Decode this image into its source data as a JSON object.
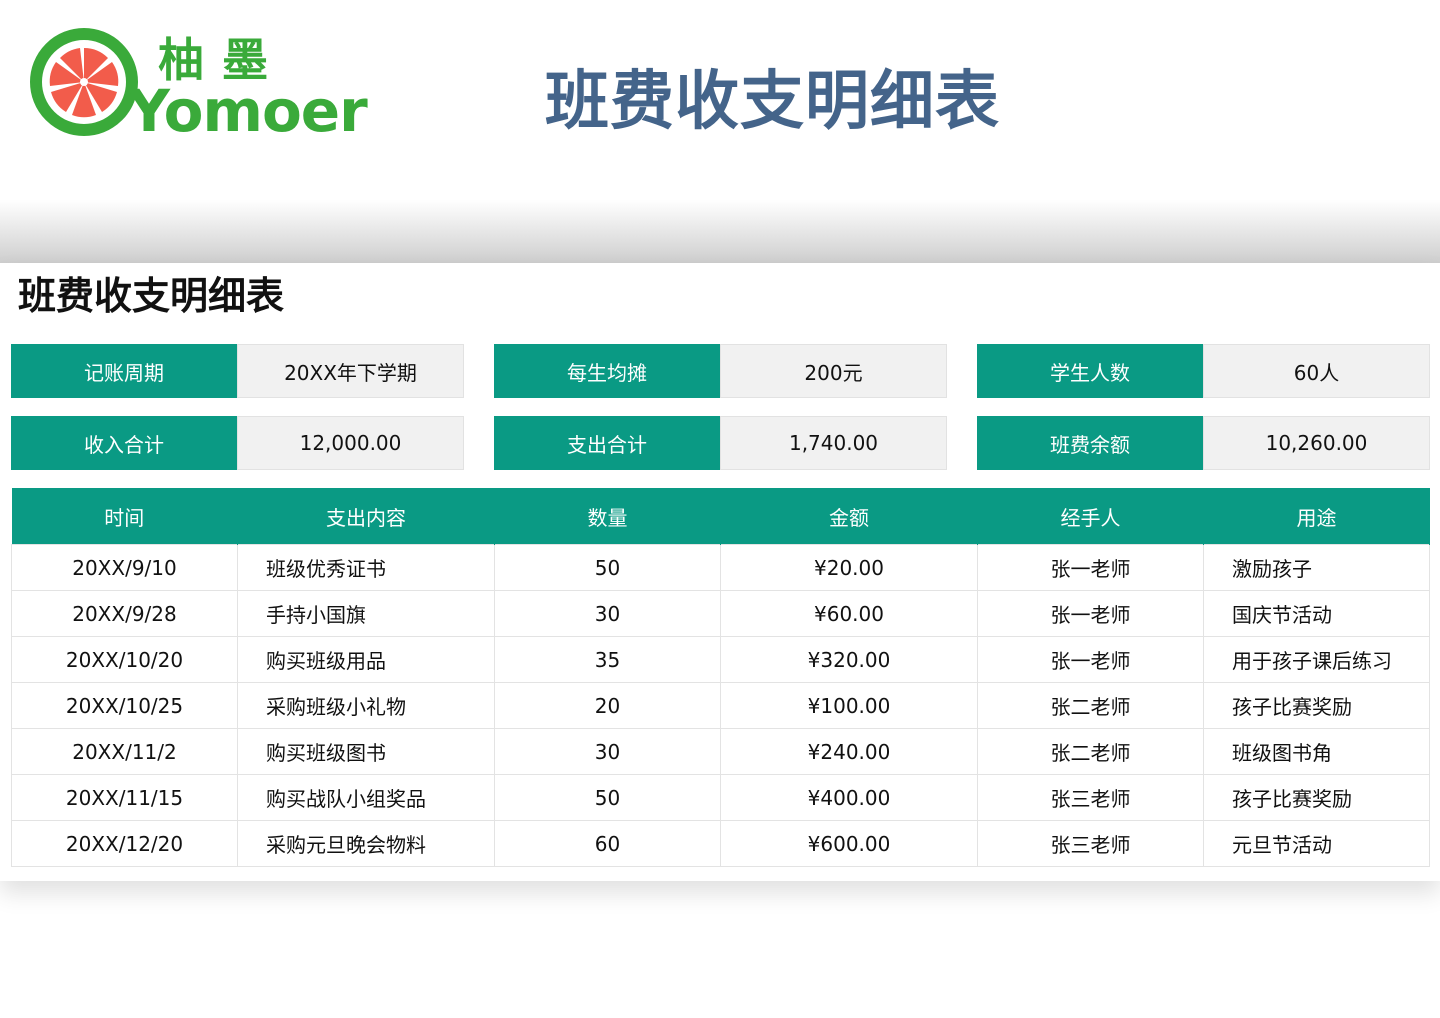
{
  "logo": {
    "chinese": "柚墨",
    "english": "Yomoer",
    "colors": {
      "ring": "#3aaa3a",
      "fruit": "#f25c4b"
    }
  },
  "main_title": "班费收支明细表",
  "sheet": {
    "title": "班费收支明细表",
    "info": [
      {
        "label": "记账周期",
        "value": "20XX年下学期"
      },
      {
        "label": "每生均摊",
        "value": "200元"
      },
      {
        "label": "学生人数",
        "value": "60人"
      },
      {
        "label": "收入合计",
        "value": "12,000.00"
      },
      {
        "label": "支出合计",
        "value": "1,740.00"
      },
      {
        "label": "班费余额",
        "value": "10,260.00"
      }
    ],
    "table": {
      "headers": [
        "时间",
        "支出内容",
        "数量",
        "金额",
        "经手人",
        "用途"
      ],
      "rows": [
        [
          "20XX/9/10",
          "班级优秀证书",
          "50",
          "¥20.00",
          "张一老师",
          "激励孩子"
        ],
        [
          "20XX/9/28",
          "手持小国旗",
          "30",
          "¥60.00",
          "张一老师",
          "国庆节活动"
        ],
        [
          "20XX/10/20",
          "购买班级用品",
          "35",
          "¥320.00",
          "张一老师",
          "用于孩子课后练习"
        ],
        [
          "20XX/10/25",
          "采购班级小礼物",
          "20",
          "¥100.00",
          "张二老师",
          "孩子比赛奖励"
        ],
        [
          "20XX/11/2",
          "购买班级图书",
          "30",
          "¥240.00",
          "张二老师",
          "班级图书角"
        ],
        [
          "20XX/11/15",
          "购买战队小组奖品",
          "50",
          "¥400.00",
          "张三老师",
          "孩子比赛奖励"
        ],
        [
          "20XX/12/20",
          "采购元旦晚会物料",
          "60",
          "¥600.00",
          "张三老师",
          "元旦节活动"
        ]
      ]
    }
  },
  "colors": {
    "accent": "#0a9a84",
    "title": "#44648a",
    "value_bg": "#f1f1f1"
  }
}
